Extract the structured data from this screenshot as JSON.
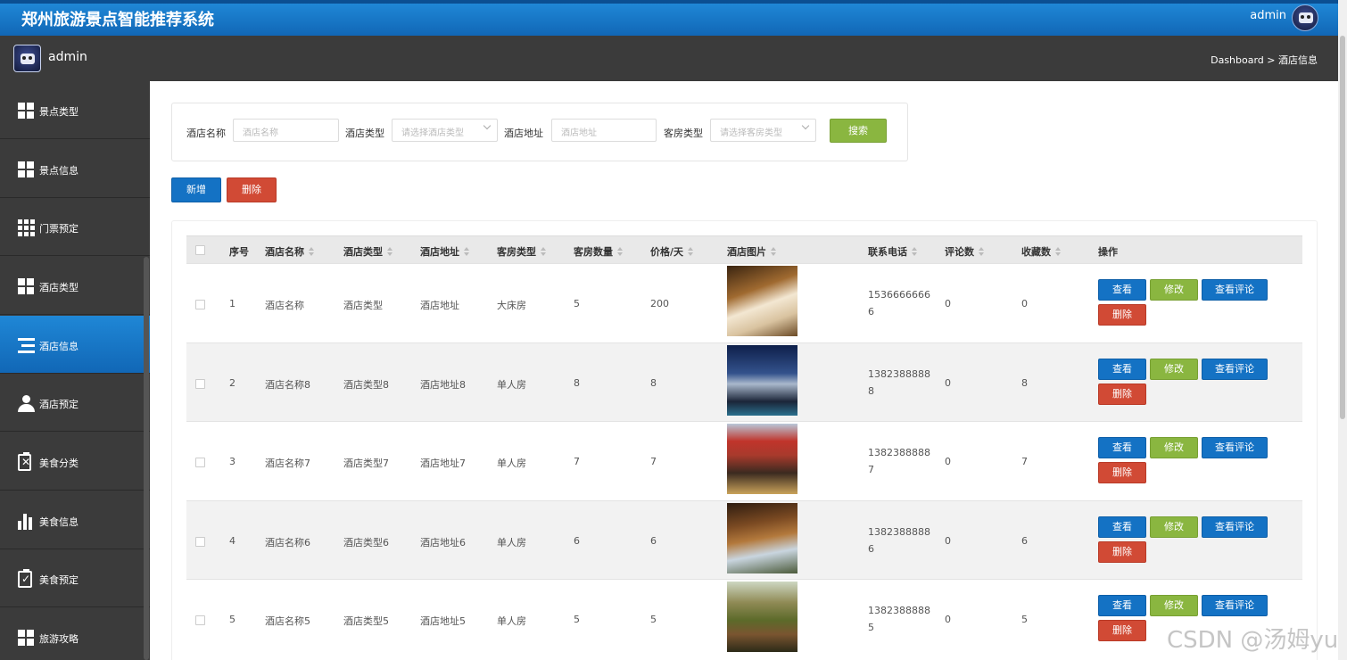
{
  "app": {
    "title": "郑州旅游景点智能推荐系统",
    "top_user": "admin"
  },
  "subbar": {
    "user": "admin",
    "breadcrumb": "Dashboard > 酒店信息"
  },
  "sidebar": {
    "items": [
      {
        "label": "景点类型",
        "icon": "grid-icon"
      },
      {
        "label": "景点信息",
        "icon": "grid-icon"
      },
      {
        "label": "门票预定",
        "icon": "grid9-icon"
      },
      {
        "label": "酒店类型",
        "icon": "grid-icon"
      },
      {
        "label": "酒店信息",
        "icon": "list-icon",
        "active": true
      },
      {
        "label": "酒店预定",
        "icon": "user-icon"
      },
      {
        "label": "美食分类",
        "icon": "clipboard-x-icon"
      },
      {
        "label": "美食信息",
        "icon": "bar-chart-icon"
      },
      {
        "label": "美食预定",
        "icon": "clipboard-check-icon"
      },
      {
        "label": "旅游攻略",
        "icon": "grid-icon"
      }
    ]
  },
  "search": {
    "name_label": "酒店名称",
    "name_placeholder": "酒店名称",
    "type_label": "酒店类型",
    "type_placeholder": "请选择酒店类型",
    "address_label": "酒店地址",
    "address_placeholder": "酒店地址",
    "room_label": "客房类型",
    "room_placeholder": "请选择客房类型",
    "button": "搜索"
  },
  "actions": {
    "add": "新增",
    "delete": "删除"
  },
  "table": {
    "headers": [
      "序号",
      "酒店名称",
      "酒店类型",
      "酒店地址",
      "客房类型",
      "客房数量",
      "价格/天",
      "酒店图片",
      "联系电话",
      "评论数",
      "收藏数",
      "操作"
    ],
    "row_buttons": {
      "view": "查看",
      "edit": "修改",
      "comments": "查看评论",
      "delete": "删除"
    },
    "rows": [
      {
        "no": "1",
        "name": "酒店名称",
        "type": "酒店类型",
        "address": "酒店地址",
        "room": "大床房",
        "count": "5",
        "price": "200",
        "phone": "15366666666",
        "comments": "0",
        "favorites": "0",
        "image": "hotel-room-photo"
      },
      {
        "no": "2",
        "name": "酒店名称8",
        "type": "酒店类型8",
        "address": "酒店地址8",
        "room": "单人房",
        "count": "8",
        "price": "8",
        "phone": "13823888888",
        "comments": "0",
        "favorites": "8",
        "image": "hotel-exterior-night-photo"
      },
      {
        "no": "3",
        "name": "酒店名称7",
        "type": "酒店类型7",
        "address": "酒店地址7",
        "room": "单人房",
        "count": "7",
        "price": "7",
        "phone": "13823888887",
        "comments": "0",
        "favorites": "7",
        "image": "hotel-entrance-photo"
      },
      {
        "no": "4",
        "name": "酒店名称6",
        "type": "酒店类型6",
        "address": "酒店地址6",
        "room": "单人房",
        "count": "6",
        "price": "6",
        "phone": "13823888886",
        "comments": "0",
        "favorites": "6",
        "image": "hotel-lobby-photo"
      },
      {
        "no": "5",
        "name": "酒店名称5",
        "type": "酒店类型5",
        "address": "酒店地址5",
        "room": "单人房",
        "count": "5",
        "price": "5",
        "phone": "13823888885",
        "comments": "0",
        "favorites": "5",
        "image": "mountain-resort-photo"
      }
    ]
  },
  "watermark": "CSDN @汤姆yu"
}
